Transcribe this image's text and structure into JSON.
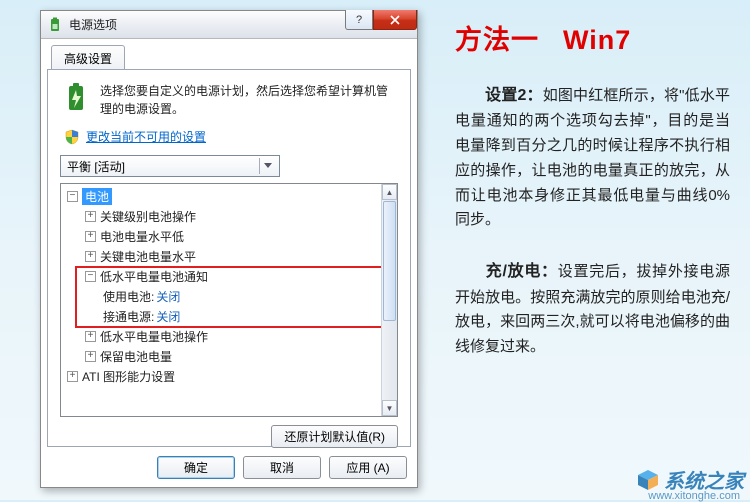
{
  "dialog": {
    "title": "电源选项",
    "tab": "高级设置",
    "intro": "选择您要自定义的电源计划，然后选择您希望计算机管理的电源设置。",
    "settings_link": "更改当前不可用的设置",
    "plan_dropdown": "平衡 [活动]",
    "restore_btn": "还原计划默认值(R)",
    "buttons": {
      "ok": "确定",
      "cancel": "取消",
      "apply": "应用 (A)"
    }
  },
  "tree": {
    "root": "电池",
    "items": [
      "关键级别电池操作",
      "电池电量水平低",
      "关键电池电量水平"
    ],
    "low_notify": {
      "label": "低水平电量电池通知",
      "use_battery_label": "使用电池:",
      "use_battery_value": "关闭",
      "on_ac_label": "接通电源:",
      "on_ac_value": "关闭"
    },
    "items2": [
      "低水平电量电池操作",
      "保留电池电量"
    ],
    "ati": "ATI 图形能力设置"
  },
  "article": {
    "heading_a": "方法一",
    "heading_b": "Win7",
    "p1_lead": "设置2：",
    "p1_body": "如图中红框所示，将\"低水平电量通知的两个选项勾去掉\"，目的是当电量降到百分之几的时候让程序不执行相应的操作，让电池的电量真正的放完，从而让电池本身修正其最低电量与曲线0%同步。",
    "p2_lead": "充/放电：",
    "p2_body": "设置完后，拔掉外接电源开始放电。按照充满放完的原则给电池充/放电，来回两三次,就可以将电池偏移的曲线修复过来。"
  },
  "watermark": {
    "text": "系统之家",
    "url": "www.xitonghe.com"
  }
}
